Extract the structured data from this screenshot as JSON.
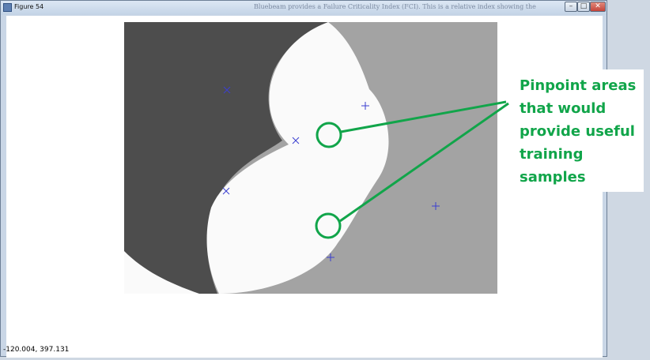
{
  "window": {
    "title": "Figure 54",
    "background_text": "Bluebeam provides a Failure Criticality Index (FCI). This is a relative index showing the",
    "minimize_glyph": "–",
    "maximize_glyph": "□",
    "close_glyph": "✕"
  },
  "status": {
    "coordinates": "-120.004,  397.131"
  },
  "annotation": {
    "text": "Pinpoint areas\nthat would\nprovide useful\ntraining\nsamples",
    "color": "#11a54a"
  },
  "plot": {
    "colors": {
      "dark_region": "#4d4d4d",
      "white_region": "#fafafa",
      "gray_region": "#a3a3a3",
      "marker": "#3b3fd0"
    },
    "markers": [
      {
        "name": "x-marker-top-left",
        "type": "x"
      },
      {
        "name": "x-marker-middle",
        "type": "x"
      },
      {
        "name": "x-marker-lower-left",
        "type": "x"
      },
      {
        "name": "plus-marker-top",
        "type": "plus"
      },
      {
        "name": "plus-marker-right",
        "type": "plus"
      },
      {
        "name": "plus-marker-bottom",
        "type": "plus"
      }
    ]
  }
}
